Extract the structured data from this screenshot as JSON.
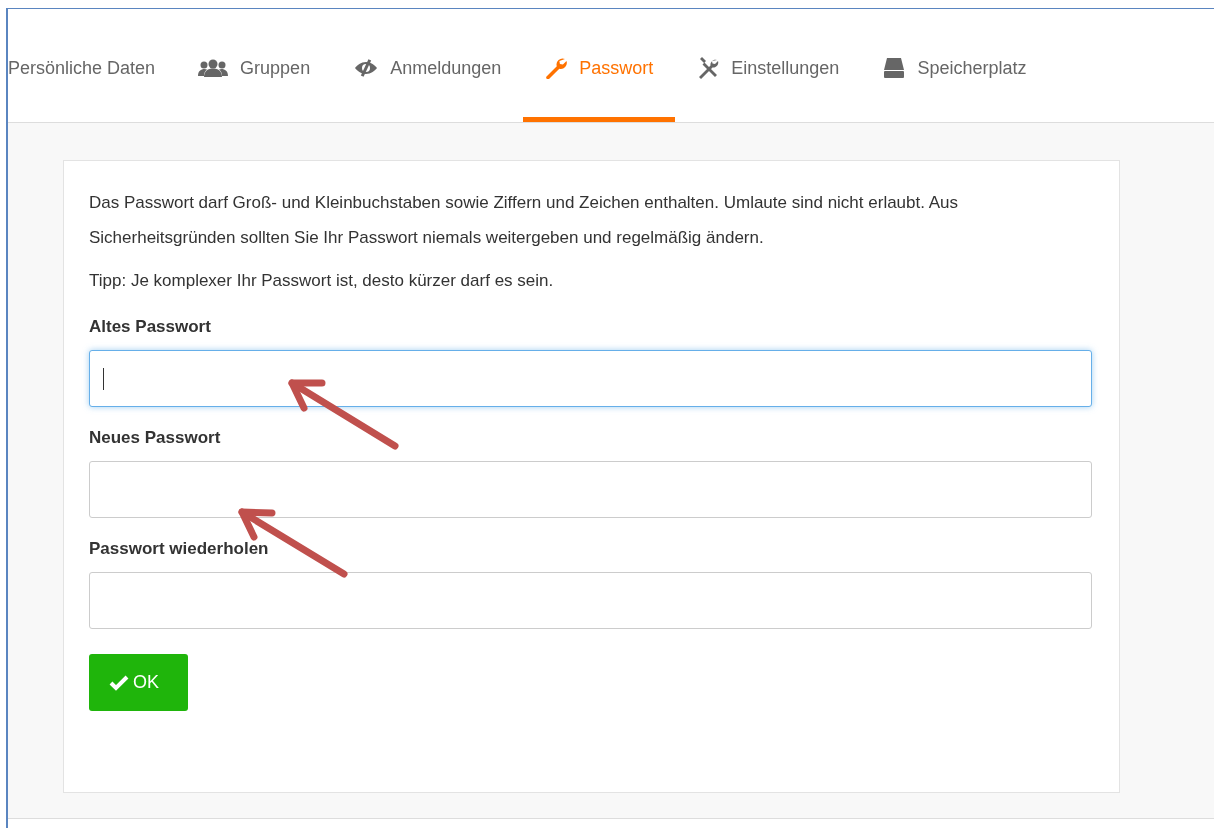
{
  "tabs": [
    {
      "label": "Persönliche Daten",
      "selected": false
    },
    {
      "label": "Gruppen",
      "selected": false
    },
    {
      "label": "Anmeldungen",
      "selected": false
    },
    {
      "label": "Passwort",
      "selected": true
    },
    {
      "label": "Einstellungen",
      "selected": false
    },
    {
      "label": "Speicherplatz",
      "selected": false
    }
  ],
  "intro": "Das Passwort darf Groß- und Kleinbuchstaben sowie Ziffern und Zeichen enthalten. Umlaute sind nicht erlaubt. Aus Sicherheitsgründen sollten Sie Ihr Passwort niemals weitergeben und regelmäßig ändern.",
  "tip": "Tipp: Je komplexer Ihr Passwort ist, desto kürzer darf es sein.",
  "fields": [
    {
      "label": "Altes Passwort",
      "focused": true
    },
    {
      "label": "Neues Passwort",
      "focused": false
    },
    {
      "label": "Passwort wiederholen",
      "focused": false
    }
  ],
  "submit": {
    "label": "OK"
  }
}
